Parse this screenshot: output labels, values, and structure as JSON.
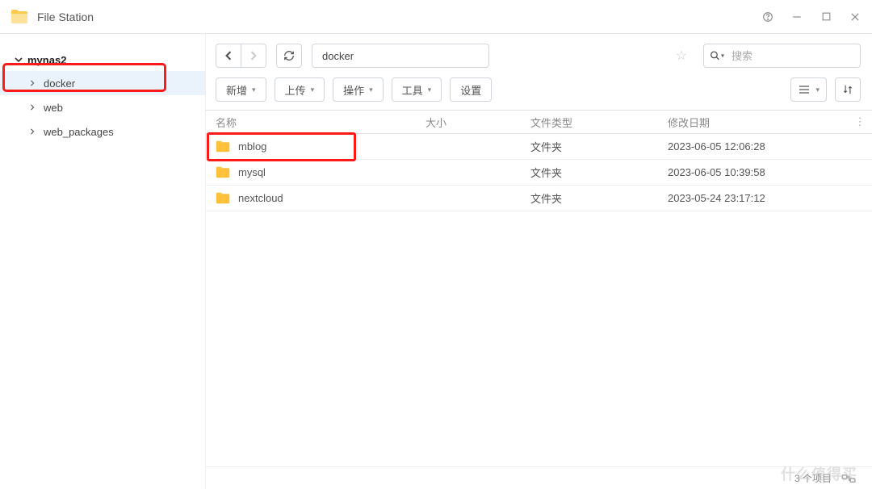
{
  "app": {
    "title": "File Station"
  },
  "sidebar": {
    "root": "mynas2",
    "items": [
      {
        "label": "docker",
        "active": true
      },
      {
        "label": "web",
        "active": false
      },
      {
        "label": "web_packages",
        "active": false
      }
    ]
  },
  "path": {
    "value": "docker"
  },
  "search": {
    "placeholder": "搜索"
  },
  "toolbar": {
    "new": "新增",
    "upload": "上传",
    "action": "操作",
    "tool": "工具",
    "settings": "设置"
  },
  "table": {
    "headers": {
      "name": "名称",
      "size": "大小",
      "type": "文件类型",
      "date": "修改日期"
    },
    "rows": [
      {
        "name": "mblog",
        "size": "",
        "type": "文件夹",
        "date": "2023-06-05 12:06:28"
      },
      {
        "name": "mysql",
        "size": "",
        "type": "文件夹",
        "date": "2023-06-05 10:39:58"
      },
      {
        "name": "nextcloud",
        "size": "",
        "type": "文件夹",
        "date": "2023-05-24 23:17:12"
      }
    ]
  },
  "status": {
    "count": "3 个项目"
  },
  "watermark": "什么值得买"
}
